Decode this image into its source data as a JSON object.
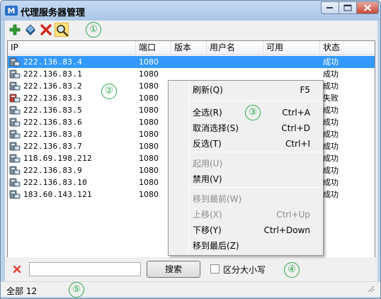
{
  "window": {
    "title": "代理服务器管理"
  },
  "toolbar": {
    "buttons": [
      "add",
      "edit",
      "delete",
      "find"
    ]
  },
  "annotations": [
    "①",
    "②",
    "③",
    "④",
    "⑤"
  ],
  "list": {
    "columns": [
      "IP",
      "端口",
      "版本",
      "用户名",
      "可用",
      "状态"
    ],
    "rows": [
      {
        "ip": "222.136.83.4",
        "port": "1080",
        "status": "成功",
        "icon": "host-icon"
      },
      {
        "ip": "222.136.83.1",
        "port": "1080",
        "status": "成功",
        "icon": "host-icon"
      },
      {
        "ip": "222.136.83.2",
        "port": "1080",
        "status": "成功",
        "icon": "host-icon"
      },
      {
        "ip": "222.136.83.3",
        "port": "1080",
        "status": "失败",
        "icon": "host-error-icon"
      },
      {
        "ip": "222.136.83.5",
        "port": "1080",
        "status": "成功",
        "icon": "host-icon"
      },
      {
        "ip": "222.136.83.6",
        "port": "1080",
        "status": "成功",
        "icon": "host-icon"
      },
      {
        "ip": "222.136.83.8",
        "port": "1080",
        "status": "成功",
        "icon": "host-icon"
      },
      {
        "ip": "222.136.83.7",
        "port": "1080",
        "status": "成功",
        "icon": "host-icon"
      },
      {
        "ip": "118.69.198.212",
        "port": "1080",
        "status": "成功",
        "icon": "host-icon"
      },
      {
        "ip": "222.136.83.9",
        "port": "1080",
        "status": "成功",
        "icon": "host-icon"
      },
      {
        "ip": "222.136.83.10",
        "port": "1080",
        "status": "成功",
        "icon": "host-icon"
      },
      {
        "ip": "183.60.143.121",
        "port": "1080",
        "status": "成功",
        "icon": "host-icon"
      }
    ]
  },
  "context_menu": {
    "items": [
      {
        "label": "刷新(Q)",
        "shortcut": "F5",
        "enabled": true
      },
      {
        "label": "全选(R)",
        "shortcut": "Ctrl+A",
        "enabled": true
      },
      {
        "label": "取消选择(S)",
        "shortcut": "Ctrl+D",
        "enabled": true
      },
      {
        "label": "反选(T)",
        "shortcut": "Ctrl+I",
        "enabled": true
      },
      {
        "label": "起用(U)",
        "shortcut": "",
        "enabled": false
      },
      {
        "label": "禁用(V)",
        "shortcut": "",
        "enabled": true
      },
      {
        "label": "移到最前(W)",
        "shortcut": "",
        "enabled": false
      },
      {
        "label": "上移(X)",
        "shortcut": "Ctrl+Up",
        "enabled": false
      },
      {
        "label": "下移(Y)",
        "shortcut": "Ctrl+Down",
        "enabled": true
      },
      {
        "label": "移到最后(Z)",
        "shortcut": "",
        "enabled": true
      }
    ]
  },
  "search": {
    "input_value": "",
    "button_label": "搜索",
    "case_label": "区分大小写",
    "case_checked": false
  },
  "status": {
    "text": "全部 12"
  }
}
